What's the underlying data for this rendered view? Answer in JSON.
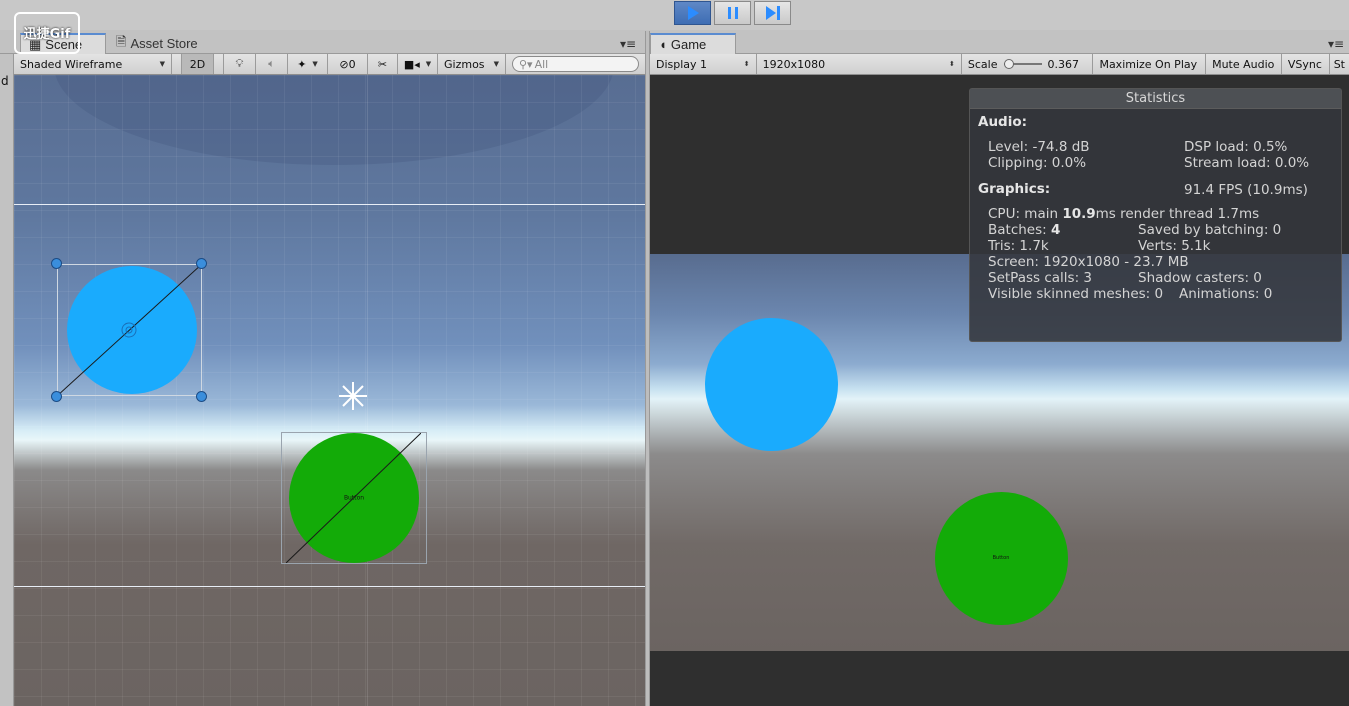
{
  "watermark": "迅捷Gif",
  "scene_panel": {
    "tabs": [
      {
        "label": "Scene",
        "icon": "grid-icon",
        "selected": true
      },
      {
        "label": "Asset Store",
        "icon": "store-icon",
        "selected": false
      }
    ],
    "toolbar": {
      "shading_mode": "Shaded Wireframe",
      "mode_2d": "2D",
      "hidden_count": "0",
      "gizmos": "Gizmos",
      "search_placeholder": "All"
    },
    "green_circle_label": "Button"
  },
  "game_panel": {
    "tab_label": "Game",
    "toolbar": {
      "display": "Display 1",
      "resolution": "1920x1080",
      "scale_label": "Scale",
      "scale_value": "0.367",
      "maximize_on_play": "Maximize On Play",
      "mute_audio": "Mute Audio",
      "vsync": "VSync",
      "stats_cut": "St"
    },
    "green_circle_label": "Button",
    "statistics": {
      "title": "Statistics",
      "audio_header": "Audio:",
      "level": "Level: -74.8 dB",
      "dsp_load": "DSP load: 0.5%",
      "clipping": "Clipping: 0.0%",
      "stream_load": "Stream load: 0.0%",
      "graphics_header": "Graphics:",
      "fps": "91.4 FPS (10.9ms)",
      "cpu_prefix": "CPU: main",
      "cpu_main_value": "10.9",
      "cpu_suffix": "ms  render thread 1.7ms",
      "batches_prefix": "Batches:",
      "batches_value": "4",
      "saved_by_batching": "Saved by batching: 0",
      "tris": "Tris: 1.7k",
      "verts": "Verts: 5.1k",
      "screen": "Screen: 1920x1080 - 23.7 MB",
      "setpass": "SetPass calls: 3",
      "shadow_casters": "Shadow casters: 0",
      "visible_skinned": "Visible skinned meshes: 0",
      "animations": "Animations: 0"
    }
  },
  "colors": {
    "blue_circle": "#1aabfd",
    "green_circle": "#13ab08",
    "play_active": "#3e6db3"
  }
}
